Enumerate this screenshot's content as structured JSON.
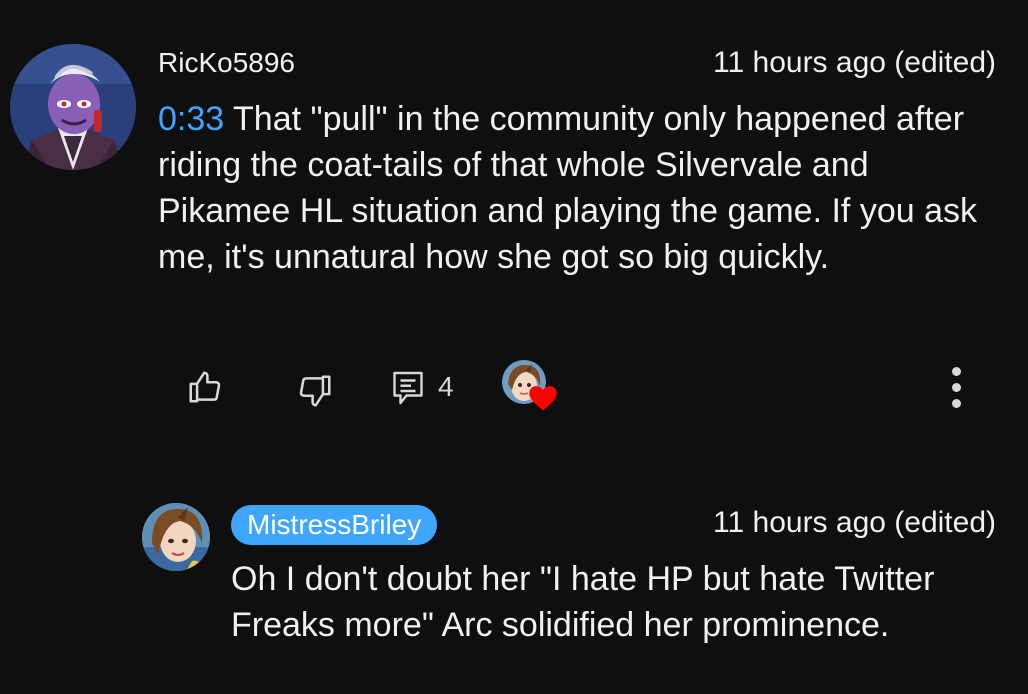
{
  "comment": {
    "author": "RicKo5896",
    "time": "11 hours ago (edited)",
    "timestamp_link": "0:33",
    "text": " That \"pull\" in the community only happened after riding the coat-tails of that whole Silvervale and Pikamee HL situation and playing the game. If you ask me, it's unnatural how she got so big quickly.",
    "reply_count": "4",
    "avatar_icon": "avatar-purple-character",
    "heart_icon": "creator-heart",
    "accent_color": "#3ea6ff",
    "heart_color": "#ff0000"
  },
  "reply": {
    "author": "MistressBriley",
    "time": "11 hours ago (edited)",
    "text": "Oh I don't doubt her \"I hate HP but hate Twitter Freaks more\" Arc solidified her prominence.",
    "avatar_icon": "avatar-anime-character"
  }
}
